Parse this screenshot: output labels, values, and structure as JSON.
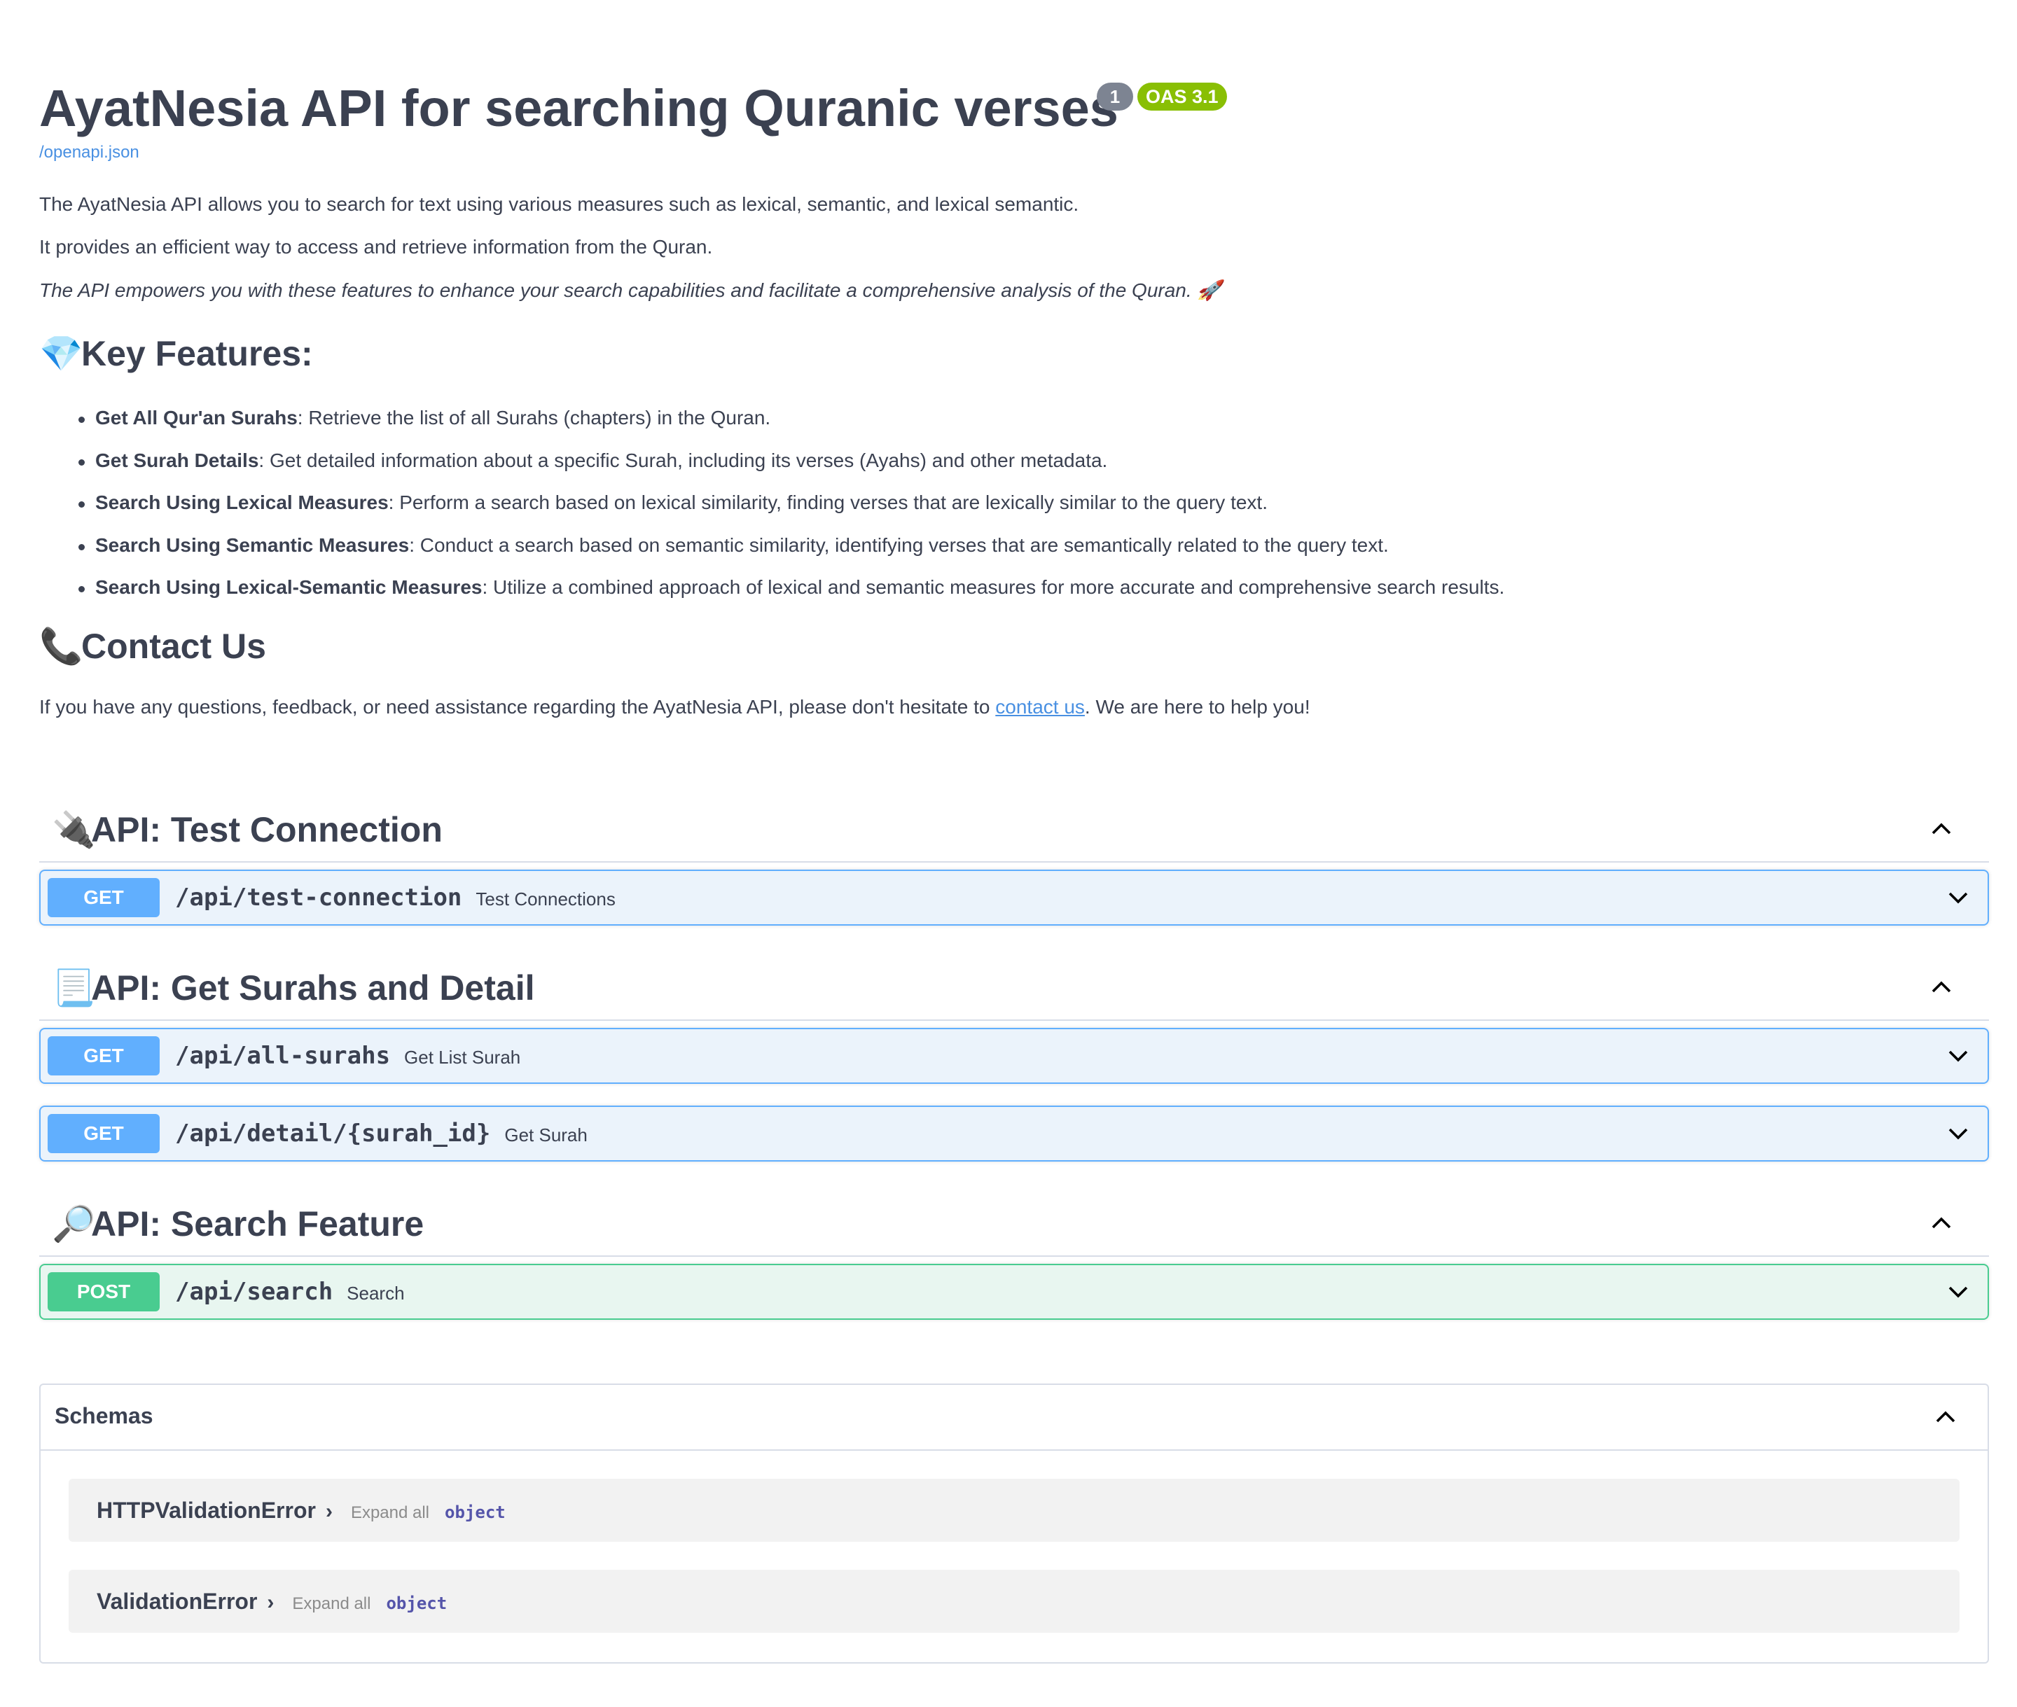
{
  "info": {
    "title": "AyatNesia API for searching Quranic verses",
    "version_badge": "1",
    "oas_badge": "OAS 3.1",
    "spec_link": "/openapi.json",
    "description_1": "The AyatNesia API allows you to search for text using various measures such as lexical, semantic, and lexical semantic.",
    "description_2": "It provides an efficient way to access and retrieve information from the Quran.",
    "description_3": "The API empowers you with these features to enhance your search capabilities and facilitate a comprehensive analysis of the Quran. 🚀",
    "features_heading": "Key Features:",
    "features_emoji": "💎",
    "features": [
      {
        "name": "Get All Qur'an Surahs",
        "text": ": Retrieve the list of all Surahs (chapters) in the Quran."
      },
      {
        "name": "Get Surah Details",
        "text": ": Get detailed information about a specific Surah, including its verses (Ayahs) and other metadata."
      },
      {
        "name": "Search Using Lexical Measures",
        "text": ": Perform a search based on lexical similarity, finding verses that are lexically similar to the query text."
      },
      {
        "name": "Search Using Semantic Measures",
        "text": ": Conduct a search based on semantic similarity, identifying verses that are semantically related to the query text."
      },
      {
        "name": "Search Using Lexical-Semantic Measures",
        "text": ": Utilize a combined approach of lexical and semantic measures for more accurate and comprehensive search results."
      }
    ],
    "contact_heading": "Contact Us",
    "contact_emoji": "📞",
    "contact_before": "If you have any questions, feedback, or need assistance regarding the AyatNesia API, please don't hesitate to ",
    "contact_link": "contact us",
    "contact_after": ". We are here to help you!"
  },
  "tags": [
    {
      "emoji": "🔌",
      "name": "API: Test Connection"
    },
    {
      "emoji": "📃",
      "name": "API: Get Surahs and Detail"
    },
    {
      "emoji": "🔎",
      "name": "API: Search Feature"
    }
  ],
  "operations": [
    {
      "method": "GET",
      "path": "/api/test-connection",
      "summary": "Test Connections"
    },
    {
      "method": "GET",
      "path": "/api/all-surahs",
      "summary": "Get List Surah"
    },
    {
      "method": "GET",
      "path": "/api/detail/{surah_id}",
      "summary": "Get Surah"
    },
    {
      "method": "POST",
      "path": "/api/search",
      "summary": "Search"
    }
  ],
  "schemas": {
    "title": "Schemas",
    "models": [
      {
        "name": "HTTPValidationError",
        "expand": "Expand all",
        "type": "object"
      },
      {
        "name": "ValidationError",
        "expand": "Expand all",
        "type": "object"
      }
    ]
  },
  "colors": {
    "get": "#61affe",
    "post": "#49cc90",
    "oas_badge": "#89bf04",
    "version_badge": "#7d8492",
    "link": "#4990e2"
  },
  "icons": {
    "tag_chevron": "chevron-up-icon",
    "op_chevron": "chevron-down-icon",
    "model_arrow": "chevron-right-icon"
  }
}
